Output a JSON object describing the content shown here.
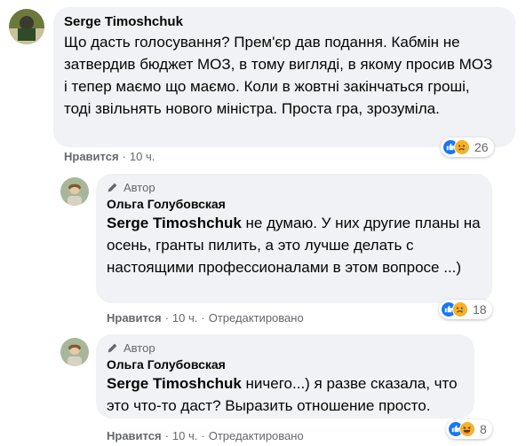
{
  "comment": {
    "author": "Serge Timoshchuk",
    "text": "Що дасть голосування? Прем'єр дав подання. Кабмін не затвердив бюджет МОЗ, в тому вигляді, в якому просив МОЗ і тепер маємо що маємо. Коли в жовтні закінчаться гроші, тоді звільнять нового міністра. Проста гра, зрозуміла.",
    "like_label": "Нравится",
    "time": "10 ч.",
    "reaction_count": "26",
    "reaction_icons": [
      "like-icon",
      "sad-icon"
    ]
  },
  "replies": [
    {
      "badge": "Автор",
      "author": "Ольга Голубовская",
      "mention": "Serge Timoshchuk",
      "text": " не думаю. У них другие планы на осень, гранты пилить, а это лучше делать с настоящими профессионалами в этом вопросе ...)",
      "like_label": "Нравится",
      "time": "10 ч.",
      "edited": "Отредактировано",
      "reaction_count": "18",
      "reaction_icons": [
        "like-icon",
        "sad-icon"
      ]
    },
    {
      "badge": "Автор",
      "author": "Ольга Голубовская",
      "mention": "Serge Timoshchuk",
      "text": " ничего...) я разве сказала, что это что-то даст? Выразить отношение просто.",
      "like_label": "Нравится",
      "time": "10 ч.",
      "edited": "Отредактировано",
      "reaction_count": "8",
      "reaction_icons": [
        "like-icon",
        "laugh-icon"
      ]
    }
  ],
  "colors": {
    "bubble": "#f0f2f5",
    "meta_text": "#65676b",
    "like_blue": "#1877f2",
    "emoji_yellow": "#f7b125"
  }
}
